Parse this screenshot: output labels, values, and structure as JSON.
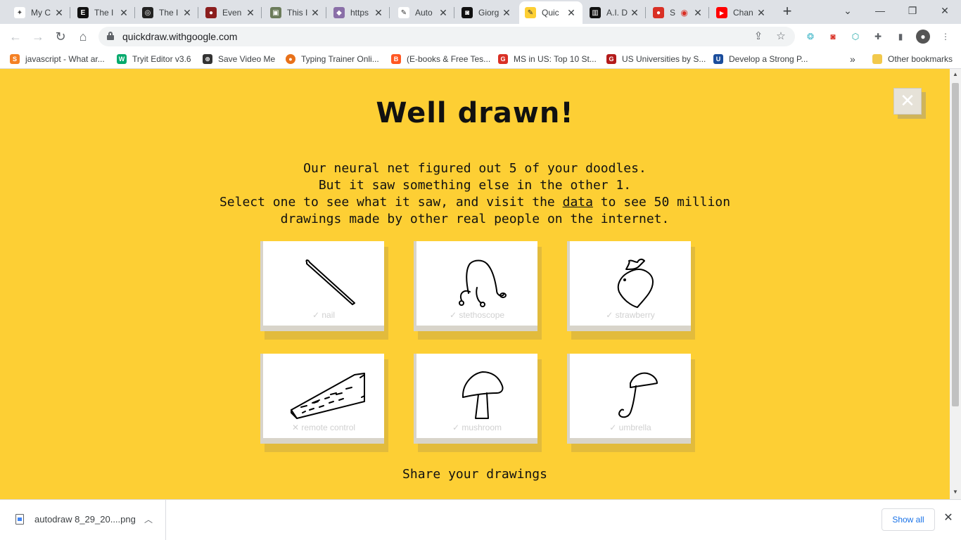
{
  "browser": {
    "tabs": [
      {
        "title": "My C",
        "color": "#444444",
        "glyph": "✦"
      },
      {
        "title": "The I",
        "color": "#111111",
        "glyph": "E"
      },
      {
        "title": "The I",
        "color": "#222222",
        "glyph": "◎"
      },
      {
        "title": "Even",
        "color": "#8b1e1e",
        "glyph": "●"
      },
      {
        "title": "This I",
        "color": "#6b7b5a",
        "glyph": "▣"
      },
      {
        "title": "https",
        "color": "#8a6fa8",
        "glyph": "◆"
      },
      {
        "title": "Auto",
        "color": "#ffffff",
        "glyph": "✎"
      },
      {
        "title": "Giorg",
        "color": "#111111",
        "glyph": "◙"
      },
      {
        "title": "Quic",
        "color": "#fdcf34",
        "glyph": "✎",
        "active": true
      },
      {
        "title": "A.I. D",
        "color": "#111111",
        "glyph": "▥"
      },
      {
        "title": "S",
        "color": "#d93025",
        "glyph": "●"
      },
      {
        "title": "Chan",
        "color": "#ff0000",
        "glyph": "▶"
      }
    ],
    "new_tab": "+",
    "window_controls": {
      "minimize": "⌄",
      "restore": "❐",
      "close": "✕"
    },
    "url": "quickdraw.withgoogle.com",
    "bookmarks": [
      {
        "label": "javascript - What ar...",
        "color": "#f48024",
        "glyph": "S"
      },
      {
        "label": "Tryit Editor v3.6",
        "color": "#04aa6d",
        "glyph": "W"
      },
      {
        "label": "Save Video Me",
        "color": "#333333",
        "glyph": "⊕"
      },
      {
        "label": "Typing Trainer Onli...",
        "color": "#e8711a",
        "glyph": "●"
      },
      {
        "label": "(E-books & Free Tes...",
        "color": "#ff5722",
        "glyph": "B"
      },
      {
        "label": "MS in US: Top 10 St...",
        "color": "#d93025",
        "glyph": "G"
      },
      {
        "label": "US Universities by S...",
        "color": "#b31b1b",
        "glyph": "G"
      },
      {
        "label": "Develop a Strong P...",
        "color": "#1a4d9c",
        "glyph": "U"
      }
    ],
    "bookmarks_more": "»",
    "other_bookmarks": "Other bookmarks"
  },
  "page": {
    "headline": "Well drawn!",
    "close": "✕",
    "message": [
      "Our neural net figured out 5 of your doodles.",
      "But it saw something else in the other 1."
    ],
    "message_line3_before": "Select one to see what it saw, and visit the ",
    "message_link": "data",
    "message_line3_after": " to see 50 million",
    "message_line4": "drawings made by other real people on the internet.",
    "doodles": [
      {
        "label": "✓ nail",
        "correct": true
      },
      {
        "label": "✓ stethoscope",
        "correct": true
      },
      {
        "label": "✓ strawberry",
        "correct": true
      },
      {
        "label": "✕ remote control",
        "correct": false
      },
      {
        "label": "✓ mushroom",
        "correct": true
      },
      {
        "label": "✓ umbrella",
        "correct": true
      }
    ],
    "share": "Share your drawings",
    "background_color": "#fdcf34"
  },
  "downloads": {
    "file": "autodraw 8_29_20....png",
    "show_all": "Show all",
    "close": "✕"
  }
}
